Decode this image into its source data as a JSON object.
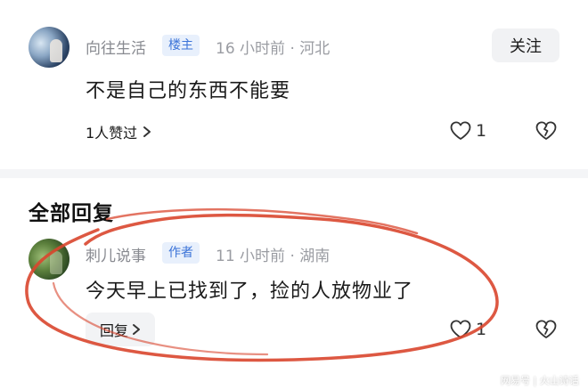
{
  "top_comment": {
    "username": "向往生活",
    "badge": "楼主",
    "meta": "16 小时前 · 河北",
    "follow_label": "关注",
    "text": "不是自己的东西不能要",
    "likes_link": "1人赞过",
    "like_count": "1"
  },
  "section": {
    "title": "全部回复"
  },
  "reply": {
    "username": "刺儿说事",
    "badge": "作者",
    "meta": "11 小时前 · 湖南",
    "text": "今天早上已找到了，捡的人放物业了",
    "reply_label": "回复",
    "like_count": "1"
  },
  "colors": {
    "badge_bg": "#e8f0fc",
    "badge_text": "#3c74d8",
    "annotation": "#d9462e"
  },
  "watermark": {
    "text": "网易号 | 火山诗话"
  }
}
